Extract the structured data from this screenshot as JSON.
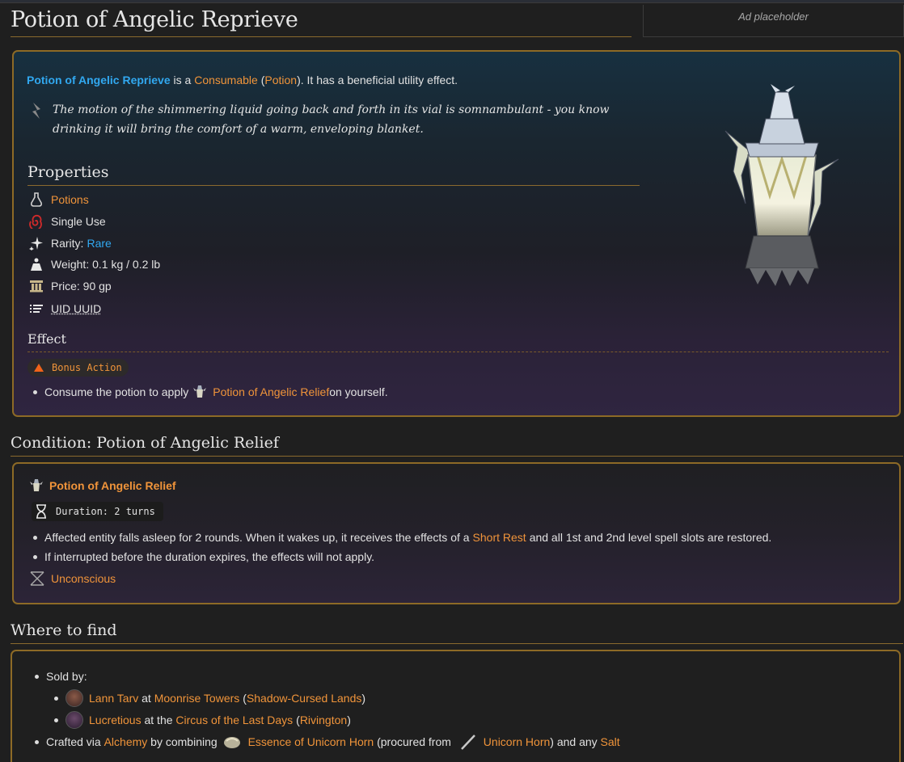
{
  "title": "Potion of Angelic Reprieve",
  "ad_placeholder": "Ad placeholder",
  "intro": {
    "name": "Potion of Angelic Reprieve",
    "is_a": " is a ",
    "category": "Consumable",
    "open_paren": " (",
    "subcategory": "Potion",
    "tail": "). It has a beneficial utility effect."
  },
  "quote": "The motion of the shimmering liquid going back and forth in its vial is somnambulant - you know drinking it will bring the comfort of a warm, enveloping blanket.",
  "properties": {
    "heading": "Properties",
    "potions": "Potions",
    "single_use": "Single Use",
    "rarity_label": "Rarity: ",
    "rarity_value": "Rare",
    "weight": "Weight: 0.1 kg / 0.2 lb",
    "price": "Price: 90 gp",
    "uid": "UID UUID"
  },
  "effect": {
    "heading": "Effect",
    "badge": "Bonus Action",
    "text_pre": "Consume the potion to apply ",
    "link": "Potion of Angelic Relief",
    "text_post": " on yourself."
  },
  "condition": {
    "heading": "Condition: Potion of Angelic Relief",
    "name": "Potion of Angelic Relief",
    "duration": "Duration: 2 turns",
    "b1_pre": "Affected entity falls asleep for 2 rounds. When it wakes up, it receives the effects of a ",
    "b1_link": "Short Rest",
    "b1_post": " and all 1st and 2nd level spell slots are restored.",
    "b2": "If interrupted before the duration expires, the effects will not apply.",
    "status": "Unconscious"
  },
  "where": {
    "heading": "Where to find",
    "sold_by": "Sold by:",
    "vendors": [
      {
        "name": "Lann Tarv",
        "at": " at ",
        "place": "Moonrise Towers",
        "region": "Shadow-Cursed Lands"
      },
      {
        "name": "Lucretious",
        "at": " at the ",
        "place": "Circus of the Last Days",
        "region": "Rivington"
      }
    ],
    "crafted": {
      "pre": "Crafted via ",
      "alchemy": "Alchemy",
      "by": " by combining ",
      "essence": "Essence of Unicorn Horn",
      "procured": " (procured from ",
      "horn": "Unicorn Horn",
      "and": ") and any ",
      "salt": "Salt"
    }
  }
}
